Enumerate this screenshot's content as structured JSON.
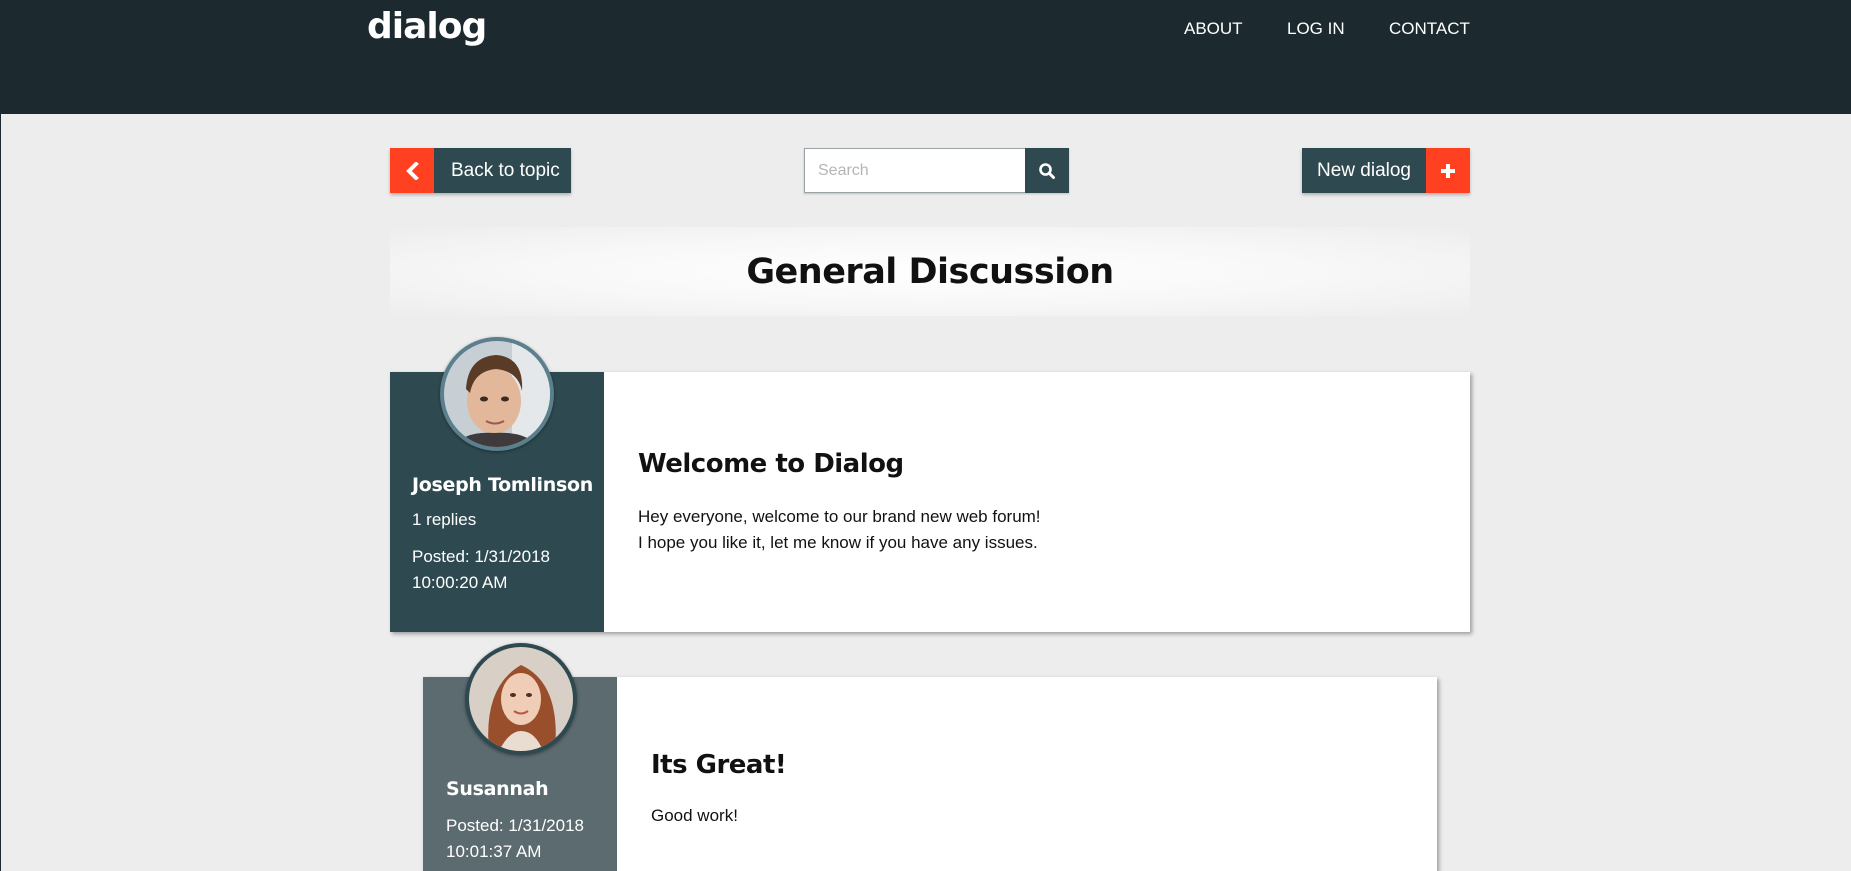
{
  "header": {
    "brand": "dialog",
    "nav": [
      "ABOUT",
      "LOG IN",
      "CONTACT"
    ]
  },
  "toolbar": {
    "back_label": "Back to topic",
    "search_placeholder": "Search",
    "new_label": "New dialog"
  },
  "topic": {
    "title": "General Discussion"
  },
  "posts": [
    {
      "author": "Joseph Tomlinson",
      "replies": "1 replies",
      "posted_label": "Posted: 1/31/2018",
      "posted_time": "10:00:20 AM",
      "title": "Welcome to Dialog",
      "body_lines": [
        "Hey everyone, welcome to our brand new web forum!",
        "I hope you like it, let me know if you have any issues."
      ]
    },
    {
      "author": "Susannah",
      "posted_label": "Posted: 1/31/2018",
      "posted_time": "10:01:37 AM",
      "title": "Its Great!",
      "body_lines": [
        "Good work!"
      ]
    }
  ],
  "colors": {
    "header_bg": "#1c2a30",
    "accent": "#ff4122",
    "primary": "#2e4a50",
    "reply_side": "#5b6b70",
    "page_bg": "#ededed"
  },
  "icons": {
    "back": "chevron-left-icon",
    "search": "search-icon",
    "new": "plus-icon"
  }
}
